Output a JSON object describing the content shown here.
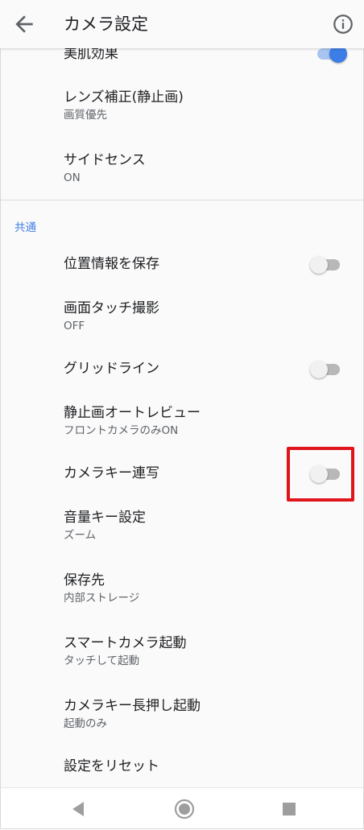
{
  "appbar": {
    "title": "カメラ設定",
    "back_icon": "arrow-back-icon",
    "info_icon": "info-icon"
  },
  "settings_top": [
    {
      "title": "美肌効果",
      "toggle": true
    },
    {
      "title": "レンズ補正(静止画)",
      "subtitle": "画質優先"
    },
    {
      "title": "サイドセンス",
      "subtitle": "ON"
    }
  ],
  "section": {
    "header": "共通"
  },
  "settings_common": [
    {
      "title": "位置情報を保存",
      "toggle": false
    },
    {
      "title": "画面タッチ撮影",
      "subtitle": "OFF"
    },
    {
      "title": "グリッドライン",
      "toggle": false
    },
    {
      "title": "静止画オートレビュー",
      "subtitle": "フロントカメラのみON"
    },
    {
      "title": "カメラキー連写",
      "toggle": false
    },
    {
      "title": "音量キー設定",
      "subtitle": "ズーム"
    },
    {
      "title": "保存先",
      "subtitle": "内部ストレージ"
    },
    {
      "title": "スマートカメラ起動",
      "subtitle": "タッチして起動"
    },
    {
      "title": "カメラキー長押し起動",
      "subtitle": "起動のみ"
    },
    {
      "title": "設定をリセット"
    }
  ],
  "navbar": {
    "back_icon": "nav-back-triangle-icon",
    "home_icon": "nav-home-circle-icon",
    "recents_icon": "nav-recents-square-icon"
  },
  "colors": {
    "accent": "#3d7de6",
    "highlight": "#e0141b",
    "toggle_off_track": "#b8b8b8",
    "toggle_off_thumb": "#f1f1f1"
  }
}
